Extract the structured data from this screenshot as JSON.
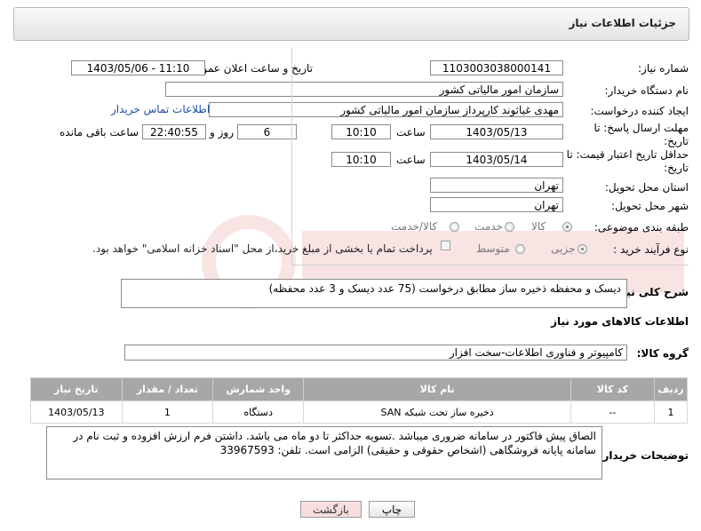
{
  "header": {
    "title": "جزئیات اطلاعات نیاز"
  },
  "fields": {
    "need_number_label": "شماره نیاز:",
    "need_number": "1103003038000141",
    "announce_label": "تاریخ و ساعت اعلان عمومی:",
    "announce_value": "1403/05/06 - 11:10",
    "buyer_org_label": "نام دستگاه خریدار:",
    "buyer_org": "سازمان امور مالیاتی کشور",
    "creator_label": "ایجاد کننده درخواست:",
    "creator": "مهدی غیاثوند کارپرداز سازمان امور مالیاتی کشور",
    "contact_link": "اطلاعات تماس خریدار",
    "deadline_label": "مهلت ارسال پاسخ: تا تاریخ:",
    "deadline_date": "1403/05/13",
    "time_label": "ساعت",
    "deadline_time": "10:10",
    "days_value": "6",
    "days_and_label": "روز و",
    "remaining_time": "22:40:55",
    "remaining_label": "ساعت باقی مانده",
    "validity_label": "حداقل تاریخ اعتبار قیمت: تا تاریخ:",
    "validity_date": "1403/05/14",
    "validity_time": "10:10",
    "province_label": "استان محل تحویل:",
    "province": "تهران",
    "city_label": "شهر محل تحویل:",
    "city": "تهران",
    "category_label": "طبقه بندی موضوعی:",
    "category_options": [
      "کالا",
      "خدمت",
      "کالا/خدمت"
    ],
    "process_label": "نوع فرآیند خرید :",
    "process_options": [
      "جزیی",
      "متوسط"
    ],
    "payment_text": "پرداخت تمام یا بخشی از مبلغ خرید،از محل \"اسناد خزانه اسلامی\" خواهد بود.",
    "description_label": "شرح کلی نیاز:",
    "description": "دیسک و محفظه ذخیره ساز  مطابق درخواست (75 عدد دیسک و 3 عدد محفظه)",
    "goods_info_title": "اطلاعات کالاهای مورد نیاز",
    "goods_group_label": "گروه کالا:",
    "goods_group": "کامپیوتر و فناوری اطلاعات-سخت افزار",
    "buyer_notes_label": "توضیحات خریدار:",
    "buyer_notes": "الصاق پیش فاکتور در سامانه ضروری میباشد .تسویه حداکثر تا دو ماه می باشد.  داشتن فرم ارزش افزوده و ثبت نام در سامانه پایانه فروشگاهی (اشخاص حقوقی و حقیقی) الزامی است. تلفن: 33967593"
  },
  "table": {
    "headers": [
      "ردیف",
      "کد کالا",
      "نام کالا",
      "واحد شمارش",
      "تعداد / مقدار",
      "تاریخ نیاز"
    ],
    "rows": [
      [
        "1",
        "--",
        "ذخیره ساز تحت شبکه SAN",
        "دستگاه",
        "1",
        "1403/05/13"
      ]
    ]
  },
  "buttons": {
    "print": "چاپ",
    "back": "بازگشت"
  },
  "colors": {
    "link": "#1a4fa8",
    "table_header": "#a7a7a7",
    "back_button": "#f6dede"
  }
}
